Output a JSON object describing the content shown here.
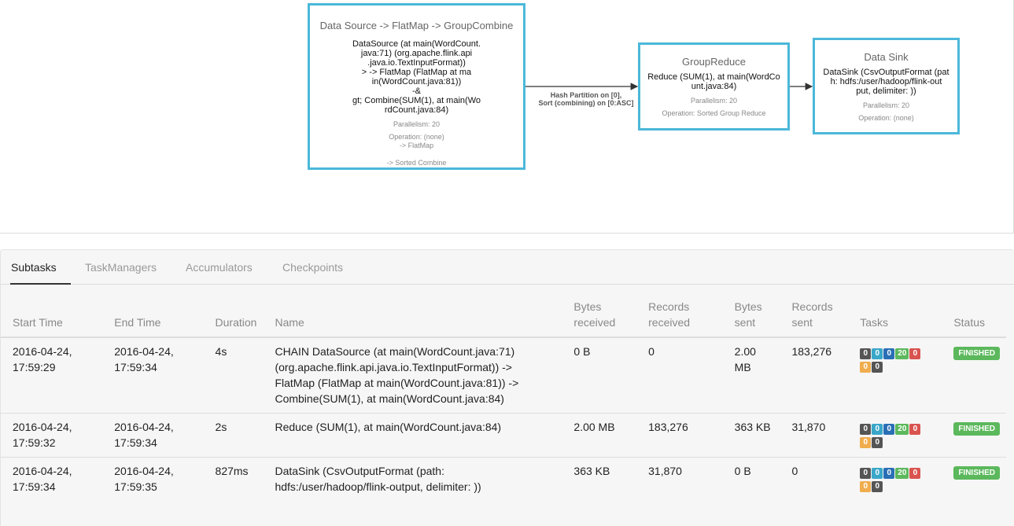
{
  "plan": {
    "nodes": [
      {
        "title": "Data Source -> FlatMap -> GroupCombine",
        "description": "DataSource (at main(WordCount.\njava:71) (org.apache.flink.api\n.java.io.TextInputFormat))\n> -> FlatMap (FlatMap at ma\nin(WordCount.java:81))\n-&\ngt; Combine(SUM(1), at main(Wo\nrdCount.java:84)",
        "parallelism": "Parallelism: 20",
        "operation": "Operation: (none)\n-> FlatMap\n\n-> Sorted Combine"
      },
      {
        "title": "GroupReduce",
        "description": "Reduce (SUM(1), at main(WordCo\nunt.java:84)",
        "parallelism": "Parallelism: 20",
        "operation": "Operation: Sorted Group Reduce"
      },
      {
        "title": "Data Sink",
        "description": "DataSink (CsvOutputFormat (pat\nh: hdfs:/user/hadoop/flink-out\nput, delimiter: ))",
        "parallelism": "Parallelism: 20",
        "operation": "Operation: (none)"
      }
    ],
    "edge_label": "Hash Partition on [0],\nSort (combining) on [0:ASC]"
  },
  "tabs": [
    {
      "label": "Subtasks",
      "active": true
    },
    {
      "label": "TaskManagers",
      "active": false
    },
    {
      "label": "Accumulators",
      "active": false
    },
    {
      "label": "Checkpoints",
      "active": false
    }
  ],
  "table": {
    "headers": {
      "start": "Start Time",
      "end": "End Time",
      "duration": "Duration",
      "name": "Name",
      "bytes_received": "Bytes\nreceived",
      "records_received": "Records\nreceived",
      "bytes_sent": "Bytes\nsent",
      "records_sent": "Records\nsent",
      "tasks": "Tasks",
      "status": "Status"
    },
    "rows": [
      {
        "start": "2016-04-24,\n17:59:29",
        "end": "2016-04-24,\n17:59:34",
        "duration": "4s",
        "name": "CHAIN DataSource (at main(WordCount.java:71)\n(org.apache.flink.api.java.io.TextInputFormat)) ->\nFlatMap (FlatMap at main(WordCount.java:81)) ->\nCombine(SUM(1), at main(WordCount.java:84)",
        "bytes_received": "0 B",
        "records_received": "0",
        "bytes_sent": "2.00 MB",
        "records_sent": "183,276",
        "tasks": [
          "0",
          "0",
          "0",
          "20",
          "0",
          "0",
          "0"
        ],
        "status": "FINISHED"
      },
      {
        "start": "2016-04-24,\n17:59:32",
        "end": "2016-04-24,\n17:59:34",
        "duration": "2s",
        "name": "Reduce (SUM(1), at main(WordCount.java:84)",
        "bytes_received": "2.00 MB",
        "records_received": "183,276",
        "bytes_sent": "363 KB",
        "records_sent": "31,870",
        "tasks": [
          "0",
          "0",
          "0",
          "20",
          "0",
          "0",
          "0"
        ],
        "status": "FINISHED"
      },
      {
        "start": "2016-04-24,\n17:59:34",
        "end": "2016-04-24,\n17:59:35",
        "duration": "827ms",
        "name": "DataSink (CsvOutputFormat (path:\nhdfs:/user/hadoop/flink-output, delimiter:  ))",
        "bytes_received": "363 KB",
        "records_received": "31,870",
        "bytes_sent": "0 B",
        "records_sent": "0",
        "tasks": [
          "0",
          "0",
          "0",
          "20",
          "0",
          "0",
          "0"
        ],
        "status": "FINISHED"
      }
    ]
  },
  "colors": {
    "node_border": "#4bb8d9",
    "status_finished": "#5cb85c",
    "task_created": "#555555",
    "task_scheduled": "#3aa7c9",
    "task_deploying": "#2a6fb5",
    "task_finished": "#5cb85c",
    "task_failed": "#d9534f",
    "task_canceling": "#f0ad4e",
    "task_canceled": "#555555"
  }
}
